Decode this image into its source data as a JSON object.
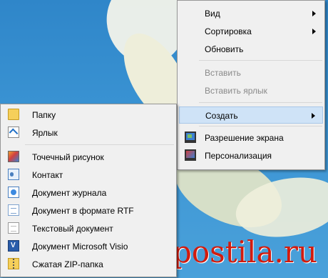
{
  "watermark": "postila.ru",
  "context_menu": {
    "items": [
      {
        "label": "Вид",
        "submenu": true,
        "enabled": true
      },
      {
        "label": "Сортировка",
        "submenu": true,
        "enabled": true
      },
      {
        "label": "Обновить",
        "submenu": false,
        "enabled": true
      },
      {
        "label": "Вставить",
        "submenu": false,
        "enabled": false
      },
      {
        "label": "Вставить ярлык",
        "submenu": false,
        "enabled": false
      },
      {
        "label": "Создать",
        "submenu": true,
        "enabled": true,
        "highlighted": true
      },
      {
        "label": "Разрешение экрана",
        "icon": "monitor-icon",
        "enabled": true
      },
      {
        "label": "Персонализация",
        "icon": "personalization-icon",
        "enabled": true
      }
    ]
  },
  "create_submenu": {
    "items": [
      {
        "label": "Папку",
        "icon": "folder-icon"
      },
      {
        "label": "Ярлык",
        "icon": "shortcut-icon"
      },
      {
        "label": "Точечный рисунок",
        "icon": "bitmap-icon"
      },
      {
        "label": "Контакт",
        "icon": "contact-icon"
      },
      {
        "label": "Документ журнала",
        "icon": "journal-icon"
      },
      {
        "label": "Документ в формате RTF",
        "icon": "rtf-document-icon"
      },
      {
        "label": "Текстовый документ",
        "icon": "text-document-icon"
      },
      {
        "label": "Документ Microsoft Visio",
        "icon": "visio-icon"
      },
      {
        "label": "Сжатая ZIP-папка",
        "icon": "zip-folder-icon"
      }
    ]
  }
}
